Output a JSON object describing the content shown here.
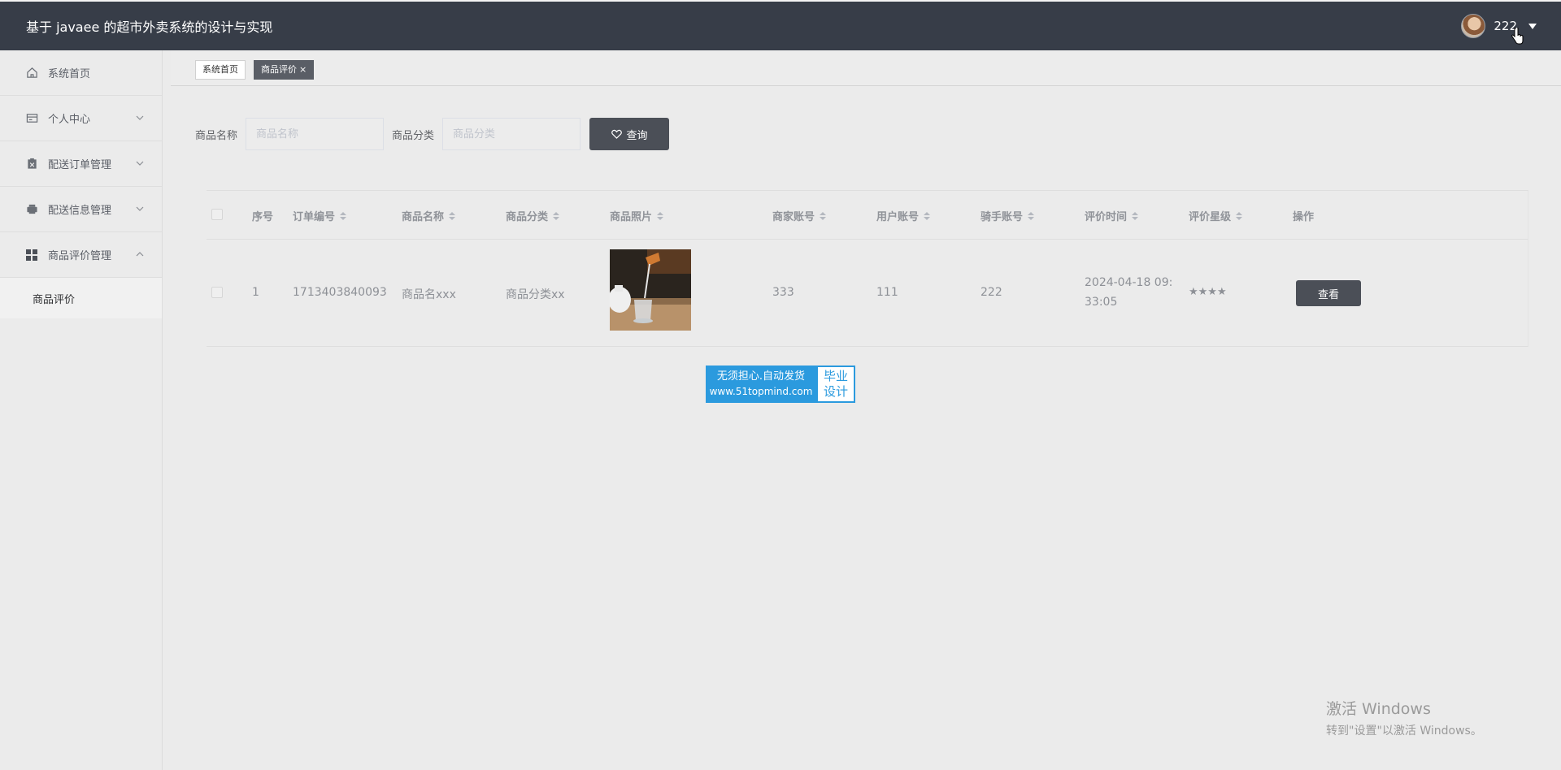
{
  "header": {
    "title": "基于 javaee 的超市外卖系统的设计与实现",
    "username": "222"
  },
  "sidebar": {
    "items": [
      {
        "label": "系统首页",
        "icon": "home-icon"
      },
      {
        "label": "个人中心",
        "icon": "card-icon"
      },
      {
        "label": "配送订单管理",
        "icon": "clipboard-icon"
      },
      {
        "label": "配送信息管理",
        "icon": "printer-icon"
      },
      {
        "label": "商品评价管理",
        "icon": "grid-icon"
      }
    ],
    "sub_items": [
      {
        "label": "商品评价"
      }
    ]
  },
  "tabs": [
    {
      "label": "系统首页"
    },
    {
      "label": "商品评价",
      "close": "×"
    }
  ],
  "search": {
    "name_label": "商品名称",
    "name_placeholder": "商品名称",
    "category_label": "商品分类",
    "category_placeholder": "商品分类",
    "query_label": "查询"
  },
  "table": {
    "columns": [
      "序号",
      "订单编号",
      "商品名称",
      "商品分类",
      "商品照片",
      "商家账号",
      "用户账号",
      "骑手账号",
      "评价时间",
      "评价星级",
      "操作"
    ],
    "rows": [
      {
        "index": "1",
        "order_no": "1713403840093",
        "product_name": "商品名xxx",
        "category": "商品分类xx",
        "merchant": "333",
        "user": "111",
        "rider": "222",
        "time_line1": "2024-04-18 09:",
        "time_line2": "33:05",
        "stars": "★★★★",
        "action": "查看"
      }
    ]
  },
  "watermark": {
    "line1": "无须担心.自动发货",
    "line2": "www.51topmind.com",
    "right1": "毕业",
    "right2": "设计"
  },
  "windows": {
    "line1": "激活 Windows",
    "line2": "转到\"设置\"以激活 Windows。"
  },
  "colors": {
    "header_bg": "#373d48",
    "button_bg": "#4b4f57",
    "ad_blue": "#2b9ade"
  }
}
